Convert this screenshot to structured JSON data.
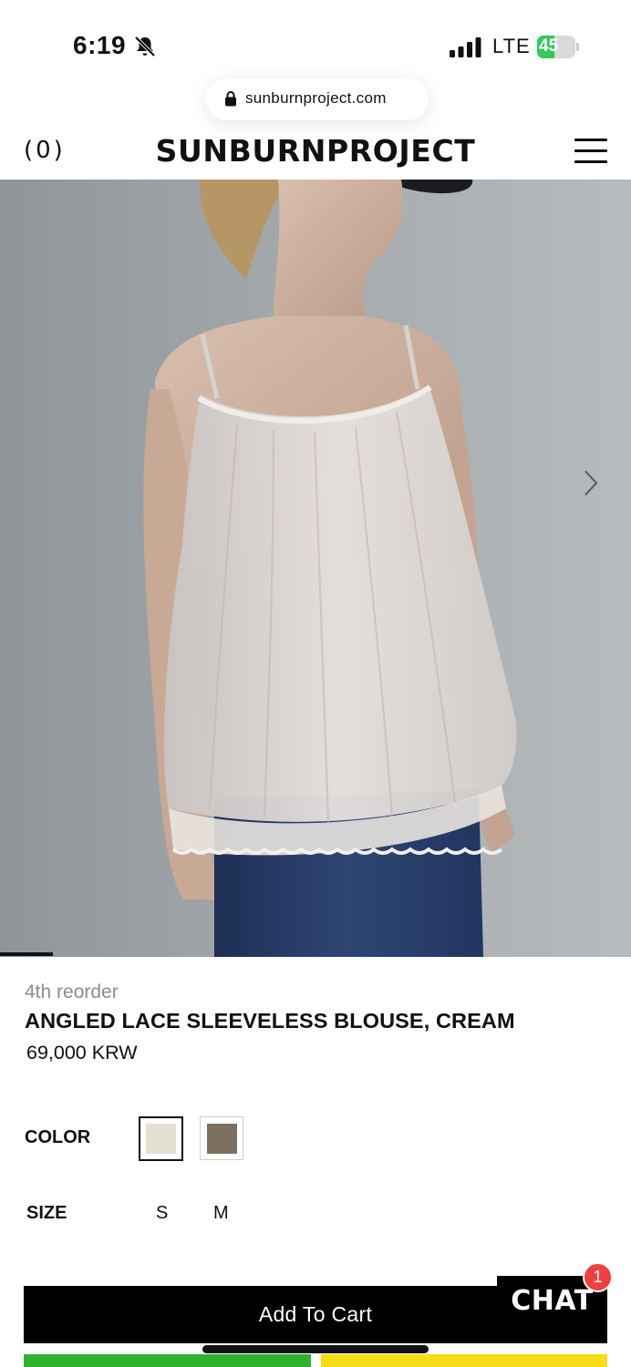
{
  "status_bar": {
    "time": "6:19",
    "network": "LTE",
    "battery_percent": "45",
    "battery_level": 0.45,
    "colors": {
      "battery_fill": "#34c759"
    }
  },
  "browser": {
    "url": "sunburnproject.com"
  },
  "header": {
    "cart_count": "(0)",
    "brand": "SUNBURNPROJECT"
  },
  "product": {
    "tag": "4th reorder",
    "name": "ANGLED LACE SLEEVELESS BLOUSE, CREAM",
    "price": "69,000 KRW",
    "color_label": "COLOR",
    "colors": [
      {
        "name": "cream",
        "hex": "#e4e1d2",
        "selected": true
      },
      {
        "name": "brown",
        "hex": "#7e7060",
        "selected": false
      }
    ],
    "size_label": "SIZE",
    "sizes": [
      "S",
      "M"
    ]
  },
  "actions": {
    "add_to_cart": "Add To Cart",
    "chat": "CHAT",
    "chat_badge": "1"
  },
  "colors": {
    "chat_badge": "#ef3f3f",
    "green_button": "#2fb32f",
    "yellow_button": "#f7dc17"
  }
}
